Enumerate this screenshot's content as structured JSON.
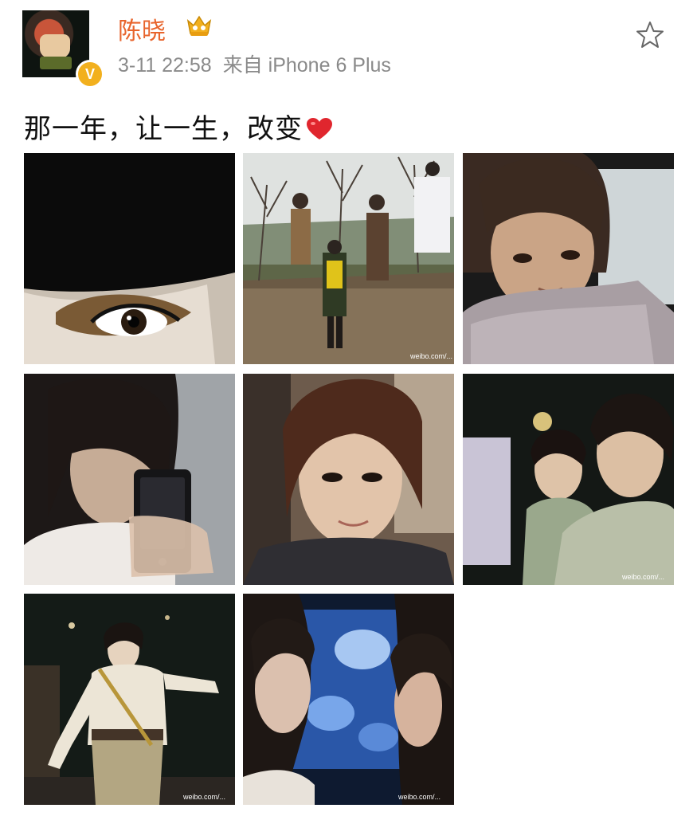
{
  "user": {
    "name": "陈晓",
    "verified_badge": "V",
    "crown_icon": "crown-icon"
  },
  "post": {
    "time": "3-11 22:58",
    "source": "来自 iPhone 6 Plus",
    "text": "那一年，让一生，改变",
    "emoji": "heart-icon"
  },
  "actions": {
    "favorite_icon": "star-icon"
  },
  "photos": [
    {
      "name": "photo-eye-closeup",
      "watermark": ""
    },
    {
      "name": "photo-forest-jump",
      "watermark": "weibo.com/..."
    },
    {
      "name": "photo-scarf-portrait",
      "watermark": ""
    },
    {
      "name": "photo-mirror-selfie",
      "watermark": ""
    },
    {
      "name": "photo-selfie-closeup",
      "watermark": ""
    },
    {
      "name": "photo-group-selfie",
      "watermark": "weibo.com/..."
    },
    {
      "name": "photo-night-costume",
      "watermark": "weibo.com/..."
    },
    {
      "name": "photo-two-faces",
      "watermark": "weibo.com/..."
    }
  ],
  "colors": {
    "username": "#e8642c",
    "meta": "#8a8a8a",
    "badge": "#f2b01e",
    "heart": "#e0262e"
  }
}
